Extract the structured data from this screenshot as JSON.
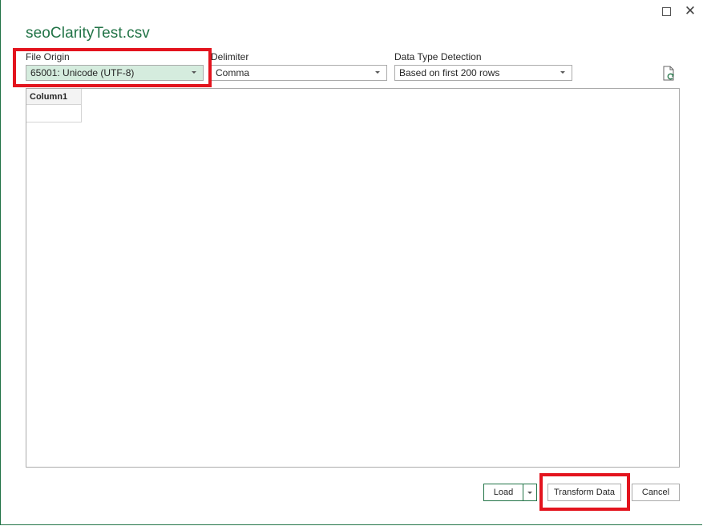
{
  "dialog": {
    "title": "seoClarityTest.csv"
  },
  "options": {
    "file_origin": {
      "label": "File Origin",
      "value": "65001: Unicode (UTF-8)"
    },
    "delimiter": {
      "label": "Delimiter",
      "value": "Comma"
    },
    "data_type_detection": {
      "label": "Data Type Detection",
      "value": "Based on first 200 rows"
    }
  },
  "icons": {
    "refresh": "refresh-file-icon",
    "maximize": "maximize-icon",
    "close": "close-icon",
    "dropdown": "chevron-down-icon"
  },
  "preview": {
    "columns": [
      "Column1"
    ],
    "rows": [
      [
        ""
      ]
    ]
  },
  "buttons": {
    "load": "Load",
    "transform": "Transform Data",
    "cancel": "Cancel"
  },
  "window": {
    "close_glyph": "✕"
  },
  "colors": {
    "accent": "#217346",
    "highlight": "#e3141e",
    "selected_field": "#d5ecde"
  }
}
